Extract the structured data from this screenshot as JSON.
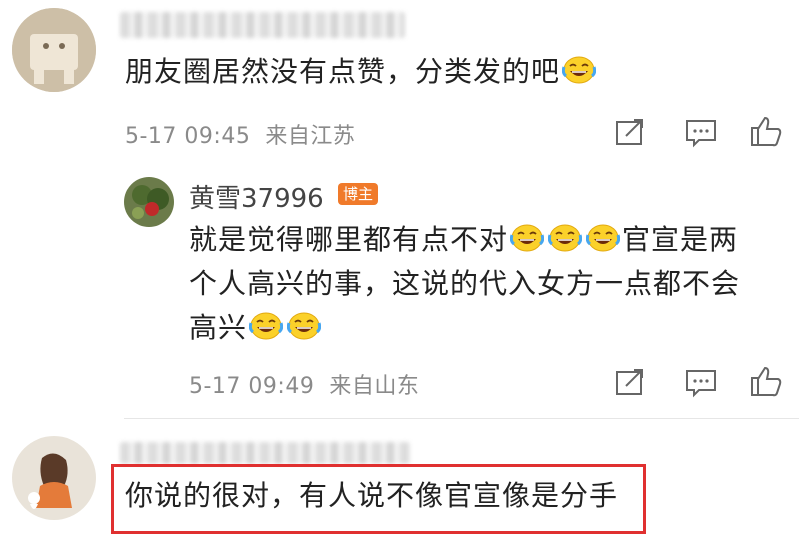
{
  "comment1": {
    "text": "朋友圈居然没有点赞，分类发的吧",
    "time": "5-17 09:45",
    "location": "来自江苏"
  },
  "reply1": {
    "author": "黄雪37996",
    "badge": "博主",
    "line1": "就是觉得哪里都有点不对",
    "line1_after": "官宣是两",
    "line2": "个人高兴的事，这说的代入女方一点都不会",
    "line3": "高兴",
    "time": "5-17 09:49",
    "location": "来自山东"
  },
  "comment2": {
    "text": "你说的很对，有人说不像官宣像是分手"
  },
  "icons": [
    "share-icon",
    "comment-icon",
    "like-icon",
    "laughing-crying-emoji"
  ],
  "colors": {
    "badge": "#f07a2a",
    "highlight": "#e03030",
    "meta": "#8a8a8a"
  }
}
